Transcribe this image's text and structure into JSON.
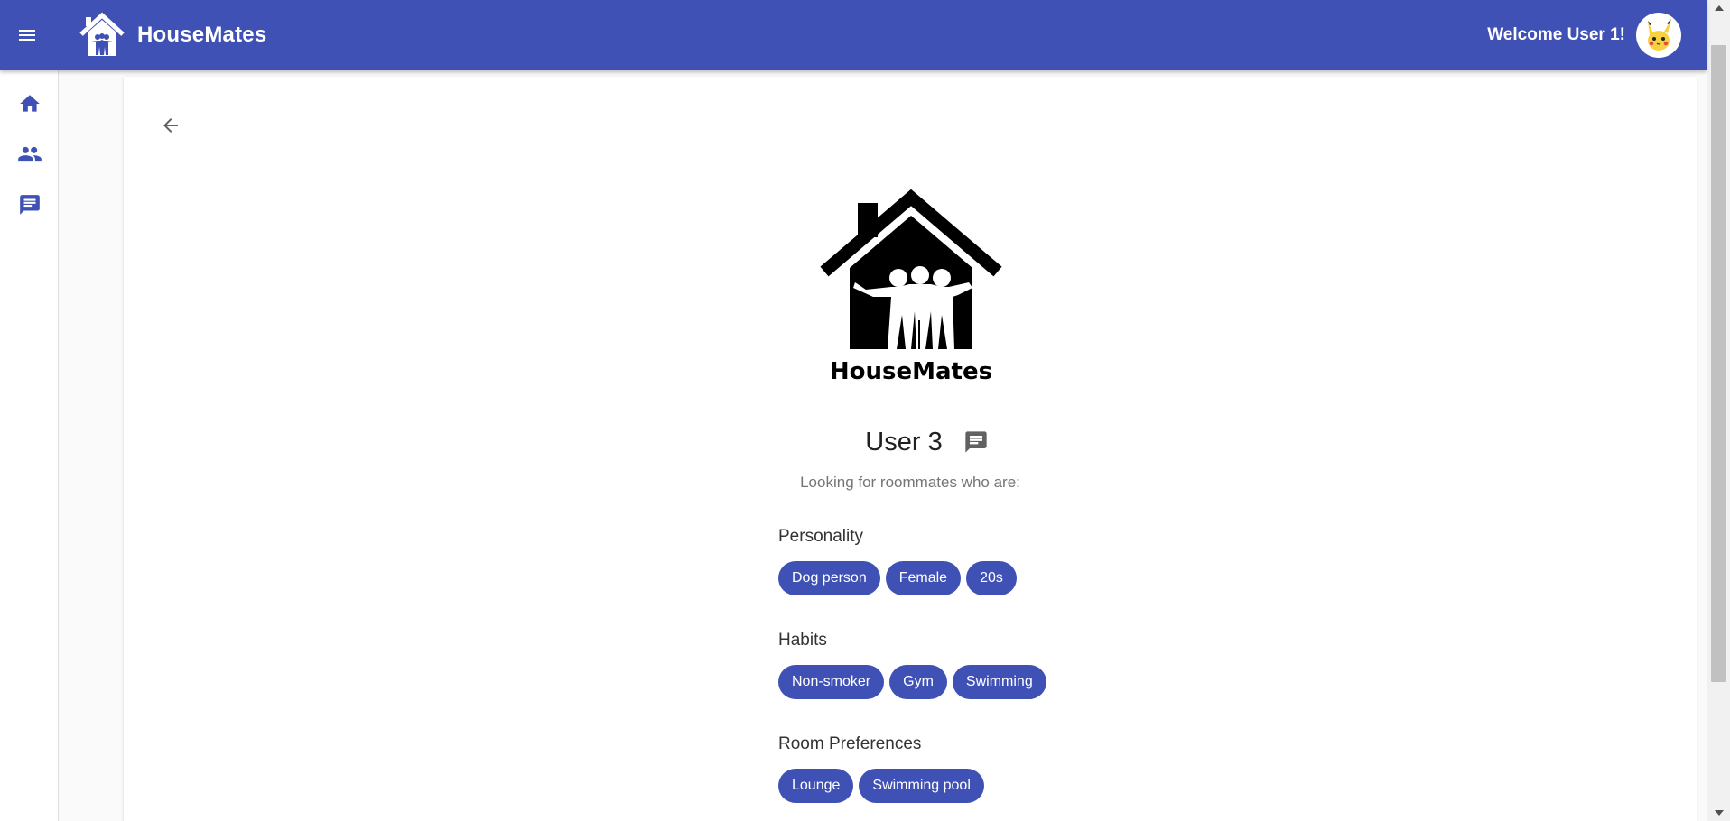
{
  "app": {
    "brand_name": "HouseMates",
    "logo_text": "HouseMates"
  },
  "header": {
    "welcome_text": "Welcome User 1!"
  },
  "profile": {
    "name": "User 3",
    "subtitle": "Looking for roommates who are:",
    "sections": [
      {
        "title": "Personality",
        "chips": [
          "Dog person",
          "Female",
          "20s"
        ]
      },
      {
        "title": "Habits",
        "chips": [
          "Non-smoker",
          "Gym",
          "Swimming"
        ]
      },
      {
        "title": "Room Preferences",
        "chips": [
          "Lounge",
          "Swimming pool"
        ]
      }
    ]
  },
  "colors": {
    "primary": "#3f51b5",
    "background": "#fafafa",
    "card": "#ffffff"
  },
  "icons": {
    "menu": "menu-icon",
    "home": "home-icon",
    "people": "people-icon",
    "chat": "chat-icon",
    "back": "arrow-back-icon"
  }
}
